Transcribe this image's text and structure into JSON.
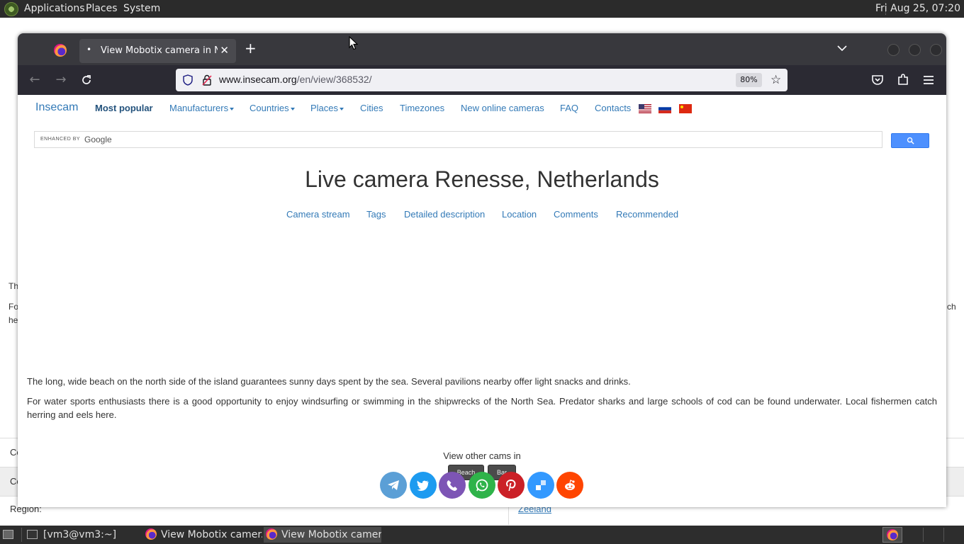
{
  "top_panel": {
    "menus": [
      "Applications",
      "Places",
      "System"
    ],
    "clock": "Fri Aug 25, 07:20"
  },
  "background_page": {
    "fragments": [
      "Th",
      "Fo",
      "he",
      "ch",
      "Co",
      "Co"
    ],
    "region_label": "Region:",
    "region_value": "Zeeland"
  },
  "browser": {
    "tab_title": "View Mobotix camera in Netherlands",
    "url_domain": "www.insecam.org",
    "url_path": "/en/view/368532/",
    "zoom": "80%"
  },
  "site": {
    "brand": "Insecam",
    "nav": [
      {
        "label": "Most popular"
      },
      {
        "label": "Manufacturers"
      },
      {
        "label": "Countries"
      },
      {
        "label": "Places"
      },
      {
        "label": "Cities"
      },
      {
        "label": "Timezones"
      },
      {
        "label": "New online cameras"
      },
      {
        "label": "FAQ"
      },
      {
        "label": "Contacts"
      }
    ],
    "search_enhanced": "ENHANCED BY",
    "search_google": "Google",
    "title": "Live camera Renesse, Netherlands",
    "subnav": [
      "Camera stream",
      "Tags",
      "Detailed description",
      "Location",
      "Comments",
      "Recommended"
    ],
    "para1": "The long, wide beach on the north side of the island guarantees sunny days spent by the sea. Several pavilions nearby offer light snacks and drinks.",
    "para2": "For water sports enthusiasts there is a good opportunity to enjoy windsurfing or swimming in the shipwrecks of the North Sea. Predator sharks and large schools of cod can be found underwater. Local fishermen catch herring and eels here.",
    "other_cams_label": "View other cams in",
    "tags": [
      "Beach",
      "Bar"
    ],
    "share_icons": [
      "telegram-icon",
      "twitter-icon",
      "viber-icon",
      "whatsapp-icon",
      "pinterest-icon",
      "delicious-icon",
      "reddit-icon"
    ],
    "share_colors": [
      "#5b9fd6",
      "#1d9bf0",
      "#7d55b5",
      "#2fb34a",
      "#cb2027",
      "#3399ff",
      "#ff4500"
    ]
  },
  "taskbar": {
    "items": [
      "[vm3@vm3:~]",
      "View Mobotix camer...",
      "View Mobotix camer..."
    ]
  }
}
